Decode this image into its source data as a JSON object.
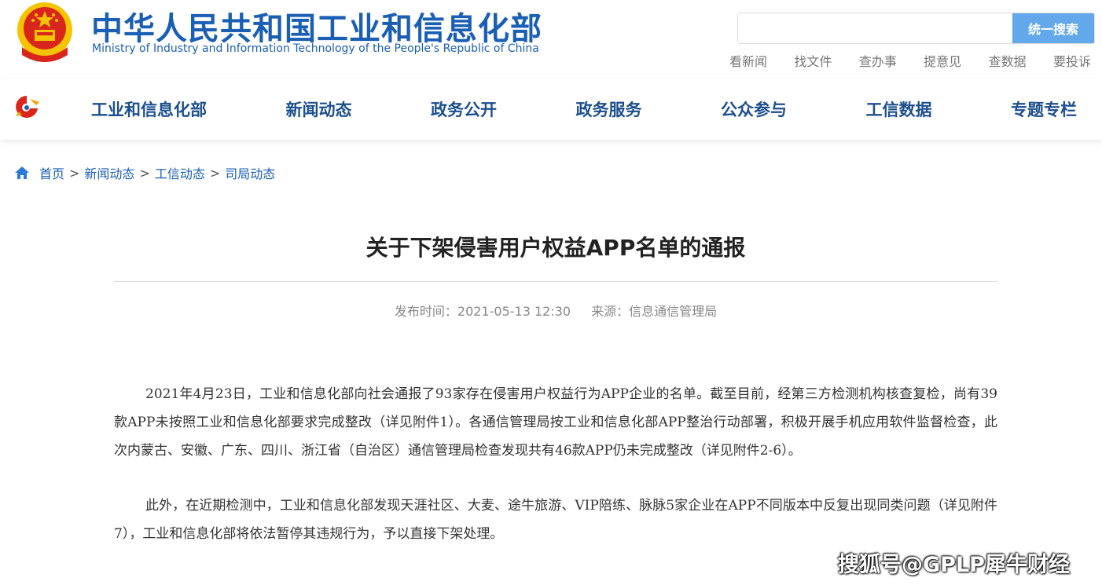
{
  "header": {
    "title_cn": "中华人民共和国工业和信息化部",
    "title_en": "Ministry of Industry and Information Technology of the People's Republic of China",
    "search": {
      "placeholder": "",
      "button_label": "统一搜索"
    },
    "quick_links": [
      "看新闻",
      "找文件",
      "查办事",
      "提意见",
      "查数据",
      "要投诉"
    ]
  },
  "nav": {
    "items": [
      "工业和信息化部",
      "新闻动态",
      "政务公开",
      "政务服务",
      "公众参与",
      "工信数据",
      "专题专栏"
    ]
  },
  "breadcrumb": {
    "items": [
      "首页",
      "新闻动态",
      "工信动态",
      "司局动态"
    ],
    "separator": ">"
  },
  "article": {
    "title": "关于下架侵害用户权益APP名单的通报",
    "publish_label": "发布时间：",
    "publish_time": "2021-05-13 12:30",
    "source_label": "来源：",
    "source": "信息通信管理局",
    "paragraphs": [
      "2021年4月23日，工业和信息化部向社会通报了93家存在侵害用户权益行为APP企业的名单。截至目前，经第三方检测机构核查复检，尚有39款APP未按照工业和信息化部要求完成整改（详见附件1）。各通信管理局按工业和信息化部APP整治行动部署，积极开展手机应用软件监督检查，此次内蒙古、安徽、广东、四川、浙江省（自治区）通信管理局检查发现共有46款APP仍未完成整改（详见附件2-6）。",
      "此外，在近期检测中，工业和信息化部发现天涯社区、大麦、途牛旅游、VIP陪练、脉脉5家企业在APP不同版本中反复出现同类问题（详见附件7），工业和信息化部将依法暂停其违规行为，予以直接下架处理。"
    ]
  },
  "watermark": "搜狐号@GPLP犀牛财经",
  "colors": {
    "brand_blue": "#1a5fb4",
    "nav_blue": "#1c4f8e",
    "search_button": "#62a8ea",
    "emblem_red": "#d9261c",
    "emblem_gold": "#f5c400"
  }
}
